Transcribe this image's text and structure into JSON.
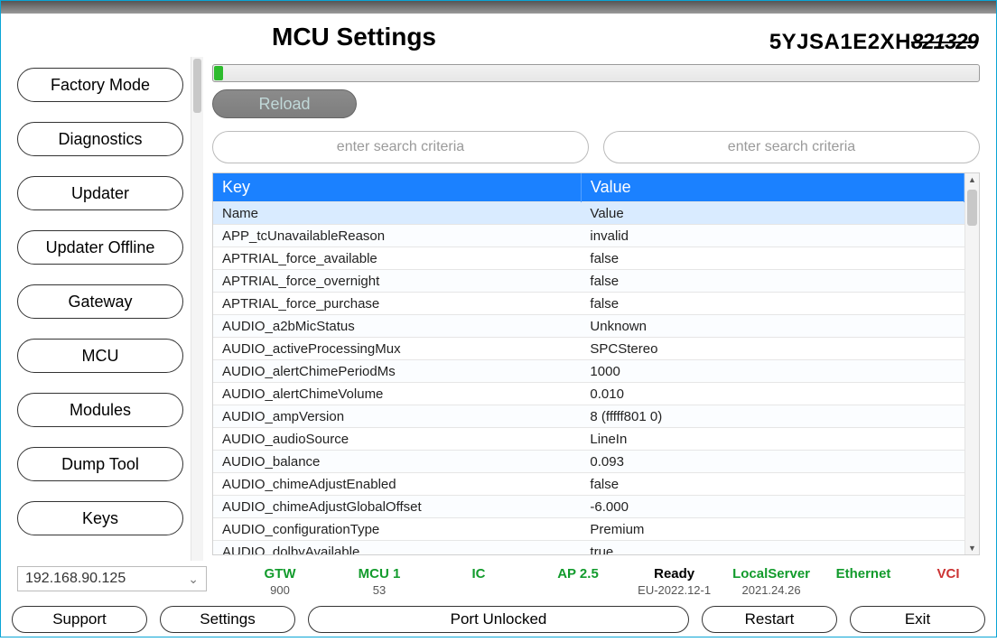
{
  "header": {
    "title": "MCU Settings",
    "vin_prefix": "5YJSA1E2XH",
    "vin_obscured": "821329"
  },
  "sidebar": {
    "items": [
      {
        "label": "Factory Mode"
      },
      {
        "label": "Diagnostics"
      },
      {
        "label": "Updater"
      },
      {
        "label": "Updater Offline"
      },
      {
        "label": "Gateway"
      },
      {
        "label": "MCU"
      },
      {
        "label": "Modules"
      },
      {
        "label": "Dump Tool"
      },
      {
        "label": "Keys"
      }
    ]
  },
  "main": {
    "reload_label": "Reload",
    "search_placeholder_left": "enter search criteria",
    "search_placeholder_right": "enter search criteria",
    "columns": {
      "key": "Key",
      "value": "Value"
    },
    "rows": [
      {
        "key": "Name",
        "value": "Value",
        "highlight": true
      },
      {
        "key": "APP_tcUnavailableReason",
        "value": "invalid"
      },
      {
        "key": "APTRIAL_force_available",
        "value": "false"
      },
      {
        "key": "APTRIAL_force_overnight",
        "value": "false"
      },
      {
        "key": "APTRIAL_force_purchase",
        "value": "false"
      },
      {
        "key": "AUDIO_a2bMicStatus",
        "value": "Unknown"
      },
      {
        "key": "AUDIO_activeProcessingMux",
        "value": "SPCStereo"
      },
      {
        "key": "AUDIO_alertChimePeriodMs",
        "value": "1000"
      },
      {
        "key": "AUDIO_alertChimeVolume",
        "value": "0.010"
      },
      {
        "key": "AUDIO_ampVersion",
        "value": "8 (fffff801 0)"
      },
      {
        "key": "AUDIO_audioSource",
        "value": "LineIn"
      },
      {
        "key": "AUDIO_balance",
        "value": "0.093"
      },
      {
        "key": "AUDIO_chimeAdjustEnabled",
        "value": "false"
      },
      {
        "key": "AUDIO_chimeAdjustGlobalOffset",
        "value": "-6.000"
      },
      {
        "key": "AUDIO_configurationType",
        "value": "Premium"
      },
      {
        "key": "AUDIO_dolbyAvailable",
        "value": "true"
      }
    ]
  },
  "status": {
    "ip": "192.168.90.125",
    "items": [
      {
        "top": "GTW",
        "sub": "900",
        "color": "green"
      },
      {
        "top": "MCU 1",
        "sub": "53",
        "color": "green"
      },
      {
        "top": "IC",
        "sub": "",
        "color": "green"
      },
      {
        "top": "AP 2.5",
        "sub": "",
        "color": "green"
      }
    ],
    "right": [
      {
        "top": "Ready",
        "sub": "EU-2022.12-1",
        "top_color": "black",
        "sub_color": "green"
      },
      {
        "top": "LocalServer",
        "sub": "2021.24.26",
        "top_color": "green",
        "sub_color": "black"
      },
      {
        "top": "Ethernet",
        "sub": "",
        "top_color": "green"
      },
      {
        "top": "VCI",
        "sub": "",
        "top_color": "red"
      }
    ]
  },
  "footer": {
    "support": "Support",
    "settings": "Settings",
    "port": "Port Unlocked",
    "restart": "Restart",
    "exit": "Exit"
  }
}
